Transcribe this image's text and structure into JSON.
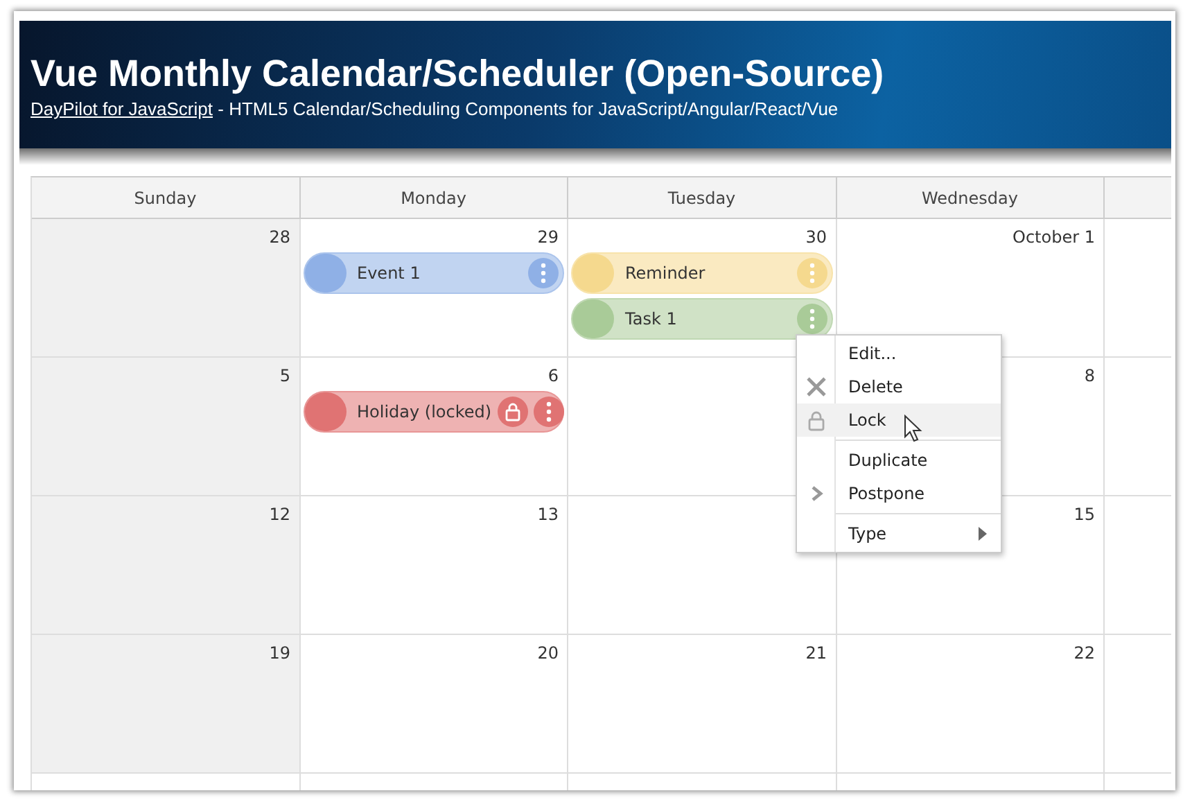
{
  "header": {
    "title": "Vue Monthly Calendar/Scheduler (Open-Source)",
    "link": "DayPilot for JavaScript",
    "subtitle": "- HTML5 Calendar/Scheduling Components for JavaScript/Angular/React/Vue"
  },
  "columns": [
    {
      "label": "Sunday",
      "shaded": true
    },
    {
      "label": "Monday",
      "shaded": false
    },
    {
      "label": "Tuesday",
      "shaded": false
    },
    {
      "label": "Wednesday",
      "shaded": false
    }
  ],
  "weeks": [
    {
      "sunday": {
        "day": "28"
      },
      "monday": {
        "day": "29",
        "events": [
          {
            "text": "Event 1",
            "color": "#8fb0e6",
            "locked": false
          }
        ]
      },
      "tuesday": {
        "day": "30",
        "events": [
          {
            "text": "Reminder",
            "color": "#f5d98e",
            "locked": false
          },
          {
            "text": "Task 1",
            "color": "#a9cb98",
            "locked": false
          }
        ]
      },
      "wednesday": {
        "day": "October 1"
      }
    },
    {
      "sunday": {
        "day": "5"
      },
      "monday": {
        "day": "6",
        "events": [
          {
            "text": "Holiday (locked)",
            "color": "#e07373",
            "locked": true
          }
        ]
      },
      "wednesday": {
        "day": "8"
      }
    },
    {
      "sunday": {
        "day": "12"
      },
      "monday": {
        "day": "13"
      },
      "wednesday": {
        "day": "15"
      }
    },
    {
      "sunday": {
        "day": "19"
      },
      "monday": {
        "day": "20"
      },
      "tuesday": {
        "day": "21"
      },
      "wednesday": {
        "day": "22"
      }
    }
  ],
  "context_menu": [
    {
      "kind": "plain",
      "text": "Edit...",
      "highlighted": false,
      "submenu": false
    },
    {
      "kind": "cross",
      "text": "Delete",
      "highlighted": false,
      "submenu": false
    },
    {
      "kind": "lock",
      "text": "Lock",
      "highlighted": true,
      "submenu": false
    },
    {
      "kind": "separator"
    },
    {
      "kind": "plain",
      "text": "Duplicate",
      "highlighted": false,
      "submenu": false
    },
    {
      "kind": "chevron",
      "text": "Postpone",
      "highlighted": false,
      "submenu": false
    },
    {
      "kind": "separator"
    },
    {
      "kind": "plain",
      "text": "Type",
      "highlighted": false,
      "submenu": true
    }
  ]
}
